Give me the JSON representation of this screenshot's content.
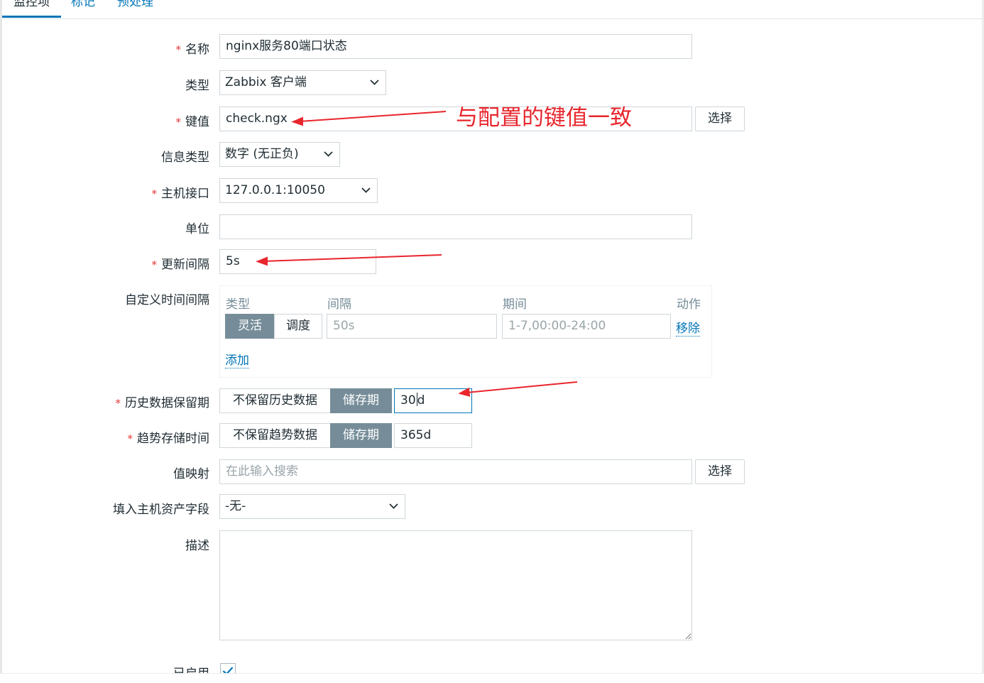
{
  "tabs": [
    {
      "label": "监控项",
      "active": true
    },
    {
      "label": "标记",
      "active": false
    },
    {
      "label": "预处理",
      "active": false
    }
  ],
  "form": {
    "name": {
      "label": "名称",
      "required": true,
      "value": "nginx服务80端口状态"
    },
    "type": {
      "label": "类型",
      "value": "Zabbix 客户端"
    },
    "key": {
      "label": "键值",
      "required": true,
      "value": "check.ngx",
      "button": "选择"
    },
    "info_type": {
      "label": "信息类型",
      "value": "数字 (无正负)"
    },
    "host_interface": {
      "label": "主机接口",
      "required": true,
      "value": "127.0.0.1:10050"
    },
    "units": {
      "label": "单位",
      "value": ""
    },
    "update_interval": {
      "label": "更新间隔",
      "required": true,
      "value": "5s"
    },
    "custom_intervals": {
      "label": "自定义时间间隔",
      "headers": {
        "type": "类型",
        "interval": "间隔",
        "period": "期间",
        "action": "动作"
      },
      "row": {
        "type_options": [
          "灵活",
          "调度"
        ],
        "type_selected": "灵活",
        "interval_placeholder": "50s",
        "period_placeholder": "1-7,00:00-24:00",
        "remove": "移除"
      },
      "add": "添加"
    },
    "history": {
      "label": "历史数据保留期",
      "required": true,
      "options": [
        "不保留历史数据",
        "储存期"
      ],
      "selected": "储存期",
      "value_before_caret": "30",
      "value_after_caret": "d"
    },
    "trends": {
      "label": "趋势存储时间",
      "required": true,
      "options": [
        "不保留趋势数据",
        "储存期"
      ],
      "selected": "储存期",
      "value": "365d"
    },
    "valuemap": {
      "label": "值映射",
      "placeholder": "在此输入搜索",
      "button": "选择"
    },
    "inventory": {
      "label": "填入主机资产字段",
      "value": "-无-"
    },
    "description": {
      "label": "描述",
      "value": ""
    },
    "enabled": {
      "label": "已启用",
      "checked": true
    }
  },
  "annotation": {
    "text": "与配置的键值一致",
    "color": "#e8262d"
  },
  "colors": {
    "accent": "#0275b8",
    "required": "#e33734",
    "segment_active": "#768d99"
  }
}
